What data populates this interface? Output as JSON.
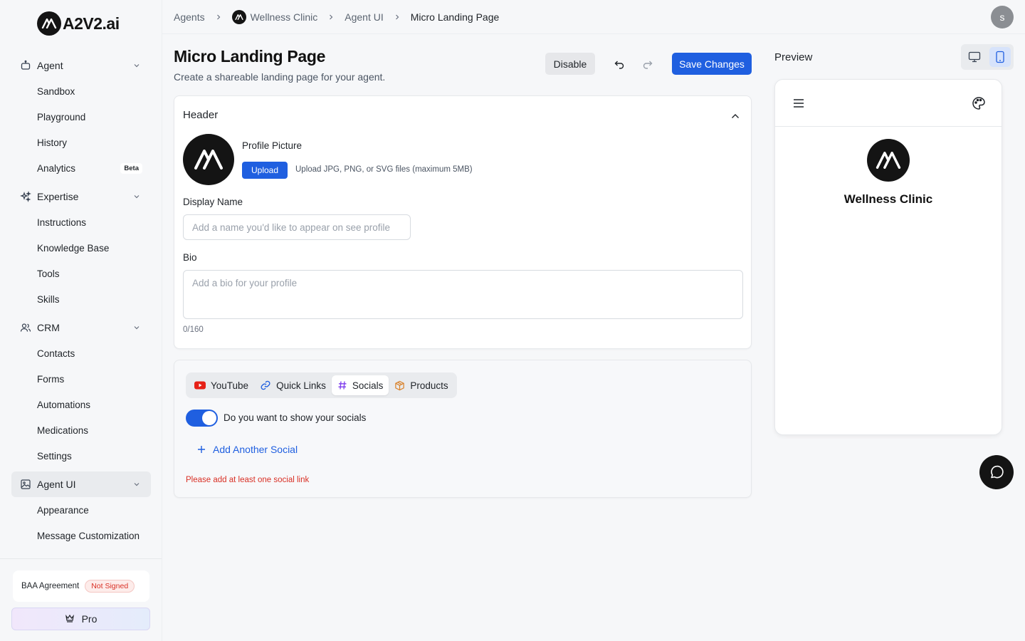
{
  "brand": {
    "name": "A2V2.ai"
  },
  "sidebar": {
    "sections": [
      {
        "label": "Agent",
        "icon": "robot-icon",
        "items": [
          {
            "label": "Sandbox"
          },
          {
            "label": "Playground"
          },
          {
            "label": "History"
          },
          {
            "label": "Analytics",
            "badge": "Beta"
          }
        ]
      },
      {
        "label": "Expertise",
        "icon": "sparkles-icon",
        "items": [
          {
            "label": "Instructions"
          },
          {
            "label": "Knowledge Base"
          },
          {
            "label": "Tools"
          },
          {
            "label": "Skills"
          }
        ]
      },
      {
        "label": "CRM",
        "icon": "users-icon",
        "items": [
          {
            "label": "Contacts"
          },
          {
            "label": "Forms"
          },
          {
            "label": "Automations"
          },
          {
            "label": "Medications"
          },
          {
            "label": "Settings"
          }
        ]
      },
      {
        "label": "Agent UI",
        "icon": "image-icon",
        "items": [
          {
            "label": "Appearance"
          },
          {
            "label": "Message Customization"
          }
        ]
      }
    ],
    "baa": {
      "label": "BAA Agreement",
      "status": "Not Signed"
    },
    "pro_label": "Pro"
  },
  "breadcrumb": {
    "items": [
      "Agents",
      "Wellness Clinic",
      "Agent UI",
      "Micro Landing Page"
    ]
  },
  "user": {
    "initial": "s"
  },
  "page": {
    "title": "Micro Landing Page",
    "subtitle": "Create a shareable landing page for your agent.",
    "disable_label": "Disable",
    "save_label": "Save Changes"
  },
  "header_card": {
    "title": "Header",
    "profile_picture_label": "Profile Picture",
    "upload_label": "Upload",
    "upload_hint": "Upload JPG, PNG, or SVG files (maximum 5MB)",
    "display_name_label": "Display Name",
    "display_name_value": "",
    "display_name_placeholder": "Add a name you'd like to appear on see profile",
    "bio_label": "Bio",
    "bio_value": "",
    "bio_placeholder": "Add a bio for your profile",
    "bio_count": "0/160"
  },
  "socials_card": {
    "tabs": [
      {
        "label": "YouTube",
        "icon": "youtube-icon",
        "active": false
      },
      {
        "label": "Quick Links",
        "icon": "link-icon",
        "active": false
      },
      {
        "label": "Socials",
        "icon": "hash-icon",
        "active": true
      },
      {
        "label": "Products",
        "icon": "package-icon",
        "active": false
      }
    ],
    "toggle_on": true,
    "toggle_label": "Do you want to show your socials",
    "add_social_label": "Add Another Social",
    "error": "Please add at least one social link"
  },
  "preview": {
    "label": "Preview",
    "mode": "mobile",
    "name": "Wellness Clinic"
  },
  "colors": {
    "accent": "#1f5fe0",
    "error": "#d93025",
    "youtube": "#e62117",
    "products": "#d9822b"
  }
}
